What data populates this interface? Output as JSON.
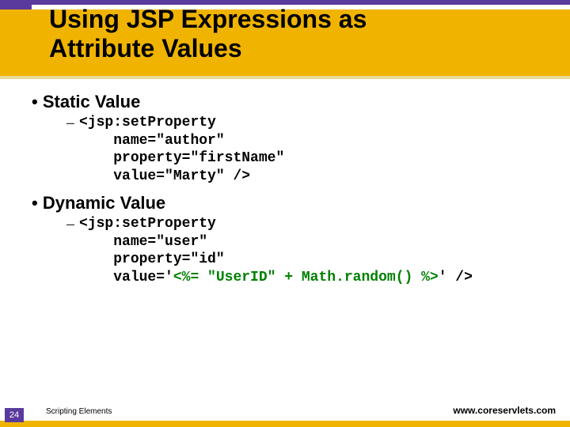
{
  "title_line1": "Using JSP Expressions as",
  "title_line2": "Attribute Values",
  "bullet1": "Static Value",
  "code1_l1": "<jsp:setProperty",
  "code1_l2": "    name=\"author\"",
  "code1_l3": "    property=\"firstName\"",
  "code1_l4": "    value=\"Marty\" />",
  "bullet2": "Dynamic Value",
  "code2_l1": "<jsp:setProperty",
  "code2_l2": "    name=\"user\"",
  "code2_l3": "    property=\"id\"",
  "code2_l4a": "    value='",
  "code2_l4b": "<%= \"UserID\" + Math.random() %>",
  "code2_l4c": "' />",
  "page_number": "24",
  "footer_section": "Scripting Elements",
  "footer_url": "www.coreservlets.com"
}
